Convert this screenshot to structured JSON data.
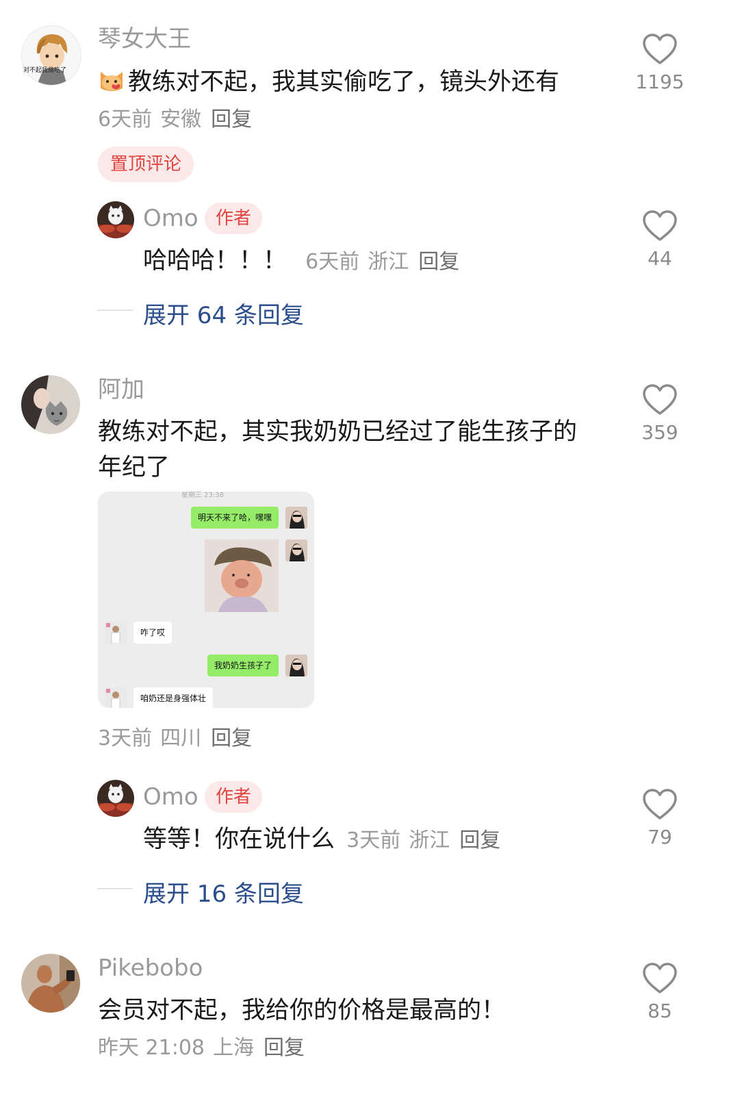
{
  "comments": [
    {
      "username": "琴女大王",
      "avatar_icon": "anime-boy-avatar-icon",
      "avatar_text": "对不起我偷吃了",
      "emoji_icon": "cat-face-emoji-icon",
      "text": "教练对不起，我其实偷吃了，镜头外还有",
      "time": "6天前",
      "location": "安徽",
      "reply_label": "回复",
      "likes": "1195",
      "pinned_label": "置顶评论",
      "author_reply": {
        "username": "Omo",
        "badge": "作者",
        "text": "哈哈哈！！！",
        "time": "6天前",
        "location": "浙江",
        "reply_label": "回复",
        "likes": "44"
      },
      "expand_label": "展开 64 条回复"
    },
    {
      "username": "阿加",
      "avatar_icon": "cat-portrait-avatar-icon",
      "text": "教练对不起，其实我奶奶已经过了能生孩子的年纪了",
      "time": "3天前",
      "location": "四川",
      "reply_label": "回复",
      "likes": "359",
      "image": {
        "top_time": "星期三 23:38",
        "messages": [
          {
            "side": "right",
            "text": "明天不来了哈，嘿嘿"
          },
          {
            "side": "right",
            "type": "photo",
            "text": ""
          },
          {
            "side": "left",
            "text": "咋了哎"
          },
          {
            "side": "right",
            "text": "我奶奶生孩子了"
          },
          {
            "side": "left",
            "text": "咱奶还是身强体壮"
          }
        ]
      },
      "author_reply": {
        "username": "Omo",
        "badge": "作者",
        "text": "等等！你在说什么",
        "time": "3天前",
        "location": "浙江",
        "reply_label": "回复",
        "likes": "79"
      },
      "expand_label": "展开 16 条回复"
    },
    {
      "username": "Pikebobo",
      "avatar_icon": "flexing-man-avatar-icon",
      "text": "会员对不起，我给你的价格是最高的！",
      "time": "昨天 21:08",
      "location": "上海",
      "reply_label": "回复",
      "likes": "85"
    }
  ],
  "colors": {
    "accent_red": "#e1453f",
    "badge_bg": "#fbe9ea",
    "link_blue": "#2b4d8c",
    "meta_gray": "#9a9a9a",
    "chat_green": "#95ec69"
  }
}
